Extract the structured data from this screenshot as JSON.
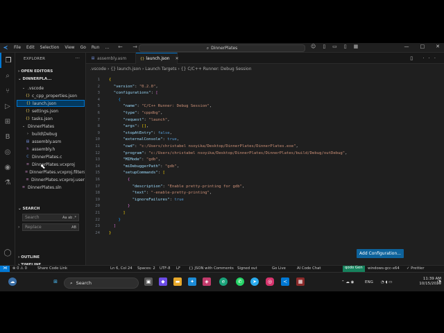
{
  "title": {
    "menu": [
      "File",
      "Edit",
      "Selection",
      "View",
      "Go",
      "Run"
    ],
    "more": "…",
    "nav": "← →",
    "search": "DinnerPlates",
    "window_controls": [
      "—",
      "□",
      "✕"
    ]
  },
  "sidebar": {
    "title": "EXPLORER",
    "open_editors": "OPEN EDITORS",
    "project": "DINNERPLA...",
    "tree": [
      {
        "label": ".vscode",
        "icon": "folder",
        "indent": 1,
        "chev": "⌄"
      },
      {
        "label": "c_cpp_properties.json",
        "icon": "json",
        "indent": 2
      },
      {
        "label": "launch.json",
        "icon": "json",
        "indent": 2,
        "selected": true
      },
      {
        "label": "settings.json",
        "icon": "json",
        "indent": 2
      },
      {
        "label": "tasks.json",
        "icon": "json",
        "indent": 2
      },
      {
        "label": "DinnerPlates",
        "icon": "folder",
        "indent": 1,
        "chev": "⌄"
      },
      {
        "label": "build\\Debug",
        "icon": "folder",
        "indent": 2,
        "chev": "›"
      },
      {
        "label": "assembly.asm",
        "icon": "asm",
        "indent": 2
      },
      {
        "label": "assembly.h",
        "icon": "h",
        "indent": 2
      },
      {
        "label": "DinnerPlates.c",
        "icon": "c",
        "indent": 2
      },
      {
        "label": "DinnerPlates.vcxproj",
        "icon": "sln",
        "indent": 2
      },
      {
        "label": "DinnerPlates.vcxproj.filters",
        "icon": "sln",
        "indent": 2
      },
      {
        "label": "DinnerPlates.vcxproj.user",
        "icon": "sln",
        "indent": 2
      },
      {
        "label": "DinnerPlates.sln",
        "icon": "sln",
        "indent": 1
      }
    ],
    "search_title": "SEARCH",
    "search_placeholder": "Search",
    "search_opts": "Aa ab .*",
    "replace_placeholder": "Replace",
    "replace_opts": "AB",
    "outline": "OUTLINE",
    "timeline": "TIMELINE"
  },
  "tabs": [
    {
      "label": "assembly.asm",
      "active": false
    },
    {
      "label": "launch.json",
      "active": true
    }
  ],
  "breadcrumb": ".vscode  ›  {} launch.json  ›  Launch Targets  ›  {} C/C++ Runner: Debug Session",
  "code_lines": [
    "{",
    "  \"version\": \"0.2.0\",",
    "  \"configurations\": [",
    "    {",
    "      \"name\": \"C/C++ Runner: Debug Session\",",
    "      \"type\": \"cppdbg\",",
    "      \"request\": \"launch\",",
    "      \"args\": [],",
    "      \"stopAtEntry\": false,",
    "      \"externalConsole\": true,",
    "      \"cwd\": \"c:/Users/christabel nsoyika/Desktop/DinnerPlates/DinnerPlates.exe\",",
    "      \"program\": \"c:/Users/christabel nsoyika/Desktop/DinnerPlates/DinnerPlates/build/Debug/outDebug\",",
    "      \"MIMode\": \"gdb\",",
    "      \"miDebuggerPath\": \"gdb\",",
    "      \"setupCommands\": [",
    "        {",
    "          \"description\": \"Enable pretty-printing for gdb\",",
    "          \"text\": \"-enable-pretty-printing\",",
    "          \"ignoreFailures\": true",
    "        }",
    "      ]",
    "    }",
    "  ]",
    "}"
  ],
  "add_config": "Add Configuration...",
  "status": {
    "remote": "⋊",
    "errors": "⊗ 0 ⚠ 0",
    "share": "Share Code Link",
    "pos": "Ln 6, Col 24",
    "spaces": "Spaces: 2",
    "enc": "UTF-8",
    "eol": "LF",
    "lang": "{} JSON with Comments",
    "signed": "Signed out",
    "golive": "Go Live",
    "aichat": "AI Code Chat",
    "qodo": "qodo Gen",
    "target": "windows-gcc-x64",
    "prettier": "✓ Prettier"
  },
  "taskbar": {
    "search": "Search",
    "lang": "ENG",
    "time": "11:39 AM",
    "date": "10/15/2025"
  },
  "colors": {
    "accent": "#0078d4",
    "button": "#0e639c",
    "qodo": "#16825d"
  }
}
